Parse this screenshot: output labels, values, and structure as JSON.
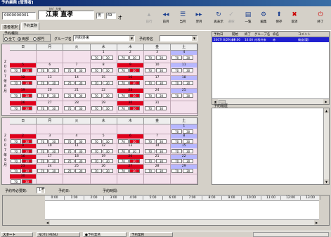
{
  "window": {
    "title": "予約業務 [管理者]"
  },
  "patient": {
    "id": "0000000001",
    "kana": "ｶｸｼﾞ ﾅｵﾀｶ",
    "name": "江東 直孝",
    "sex": "男",
    "age": "69",
    "age_unit": "才"
  },
  "toolbar": {
    "prev_disabled": "前行",
    "prev_month": "前月",
    "next_month": "翌月",
    "redisplay": "再表示",
    "select": "選択",
    "list": "一覧",
    "edit": "編集",
    "save": "保存",
    "cancel": "取消",
    "exit": "終了"
  },
  "tabs": [
    "患者選択",
    "予約業務"
  ],
  "filter": {
    "kind_label": "予約種別",
    "opt_all": "全て",
    "opt_both": "両部",
    "opt_dept": "部門",
    "group_label": "グループ名",
    "group_value": "内科外来",
    "slot_label": "予約枠名",
    "slot_value": ""
  },
  "weekdays": [
    "日",
    "月",
    "火",
    "水",
    "木",
    "金",
    "土"
  ],
  "calendars": [
    {
      "month_label": [
        "2",
        "0",
        "0",
        "7",
        "年",
        "8",
        "月"
      ],
      "weeks": [
        [
          "",
          "",
          "",
          "1",
          "2",
          "3",
          "4"
        ],
        [
          "5",
          "6",
          "7",
          "8",
          "9",
          "10",
          "11"
        ],
        [
          "12",
          "13",
          "14",
          "15",
          "16",
          "17",
          "18"
        ],
        [
          "19",
          "20",
          "21",
          "22",
          "23",
          "24",
          "25"
        ],
        [
          "26",
          "27",
          "28",
          "29",
          "30",
          "31",
          ""
        ]
      ]
    },
    {
      "month_label": [
        "2",
        "0",
        "0",
        "7",
        "年",
        "9",
        "月"
      ],
      "weeks": [
        [
          "",
          "",
          "",
          "",
          "",
          "",
          "1"
        ],
        [
          "2",
          "3",
          "4",
          "5",
          "6",
          "7",
          "8"
        ],
        [
          "9",
          "10",
          "11",
          "12",
          "13",
          "14",
          "15"
        ],
        [
          "16",
          "17",
          "18",
          "19",
          "20",
          "21",
          "22"
        ],
        [
          "23",
          "24",
          "25",
          "26",
          "27",
          "28",
          "29"
        ],
        [
          "30",
          "",
          "",
          "",
          "",
          "",
          ""
        ]
      ]
    }
  ],
  "slot_a": "70",
  "slot_b": "30",
  "reservation_table": {
    "headers": [
      "予約日",
      "開始",
      "終了",
      "グループ名",
      "枠名",
      "コメント"
    ],
    "row": [
      "2007/ 8/29(水)",
      "09:00",
      "10:00",
      "内科外来",
      "赤",
      "検査(要)"
    ]
  },
  "history": {
    "label": "予約履歴"
  },
  "bottom": {
    "needed_label": "予約枠必要数:",
    "needed_value": "1",
    "date_label": "予約日:",
    "time_label": "予約時間:",
    "times": [
      "0:00",
      "1:00",
      "2:00",
      "3:00",
      "4:00",
      "5:00",
      "6:00",
      "7:00",
      "8:00",
      "9:00",
      "10:00",
      "11:00",
      "12:00",
      "13:00"
    ]
  },
  "taskbar": [
    "スタート",
    "NOTE MENU",
    "●予約業務",
    "予約業務"
  ],
  "colors": {
    "calendar_bg": "#f4e1ec",
    "red": "#e0001b",
    "blue_sat": "#b7b7ff",
    "selection": "#2020d0"
  }
}
